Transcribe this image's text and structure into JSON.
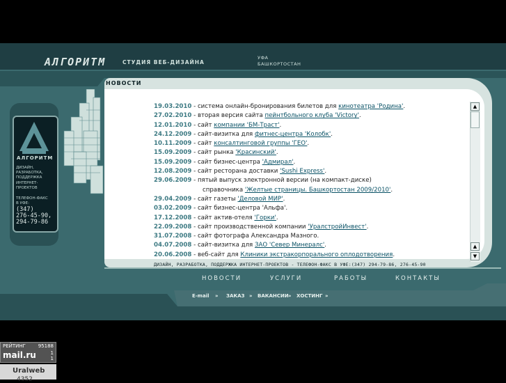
{
  "brand": {
    "name": "АЛГОРИТМ",
    "studio": "СТУДИЯ ВЕБ-ДИЗАЙНА",
    "city": "УФА",
    "region": "БАШКОРТОСТАН"
  },
  "left_card": {
    "name": "АЛГОРИТМ",
    "services": [
      "ДИЗАЙН,",
      "РАЗРАБОТКА,",
      "ПОДДЕРЖКА",
      "ИНТЕРНЕТ-",
      "ПРОЕКТОВ"
    ],
    "phone_label": [
      "ТЕЛЕФОН-ФАКС",
      "В УФЕ:"
    ],
    "phone_code": "(347)",
    "phones": [
      "276-45-90,",
      "294-79-86"
    ]
  },
  "news": {
    "title": "НОВОСТИ",
    "items": [
      {
        "date": "19.03.2010",
        "pre": " - система онлайн-бронирования билетов для ",
        "link": "кинотеатра 'Родина'",
        "post": "."
      },
      {
        "date": "27.02.2010",
        "pre": " - вторая версия сайта ",
        "link": "пейнтбольного клуба 'Victory'",
        "post": "."
      },
      {
        "date": "12.01.2010",
        "pre": " - сайт ",
        "link": "компании 'БМ-Траст'",
        "post": "."
      },
      {
        "date": "24.12.2009",
        "pre": " - сайт-визитка для ",
        "link": "фитнес-центра 'Колобк'",
        "post": "."
      },
      {
        "date": "10.11.2009",
        "pre": " - сайт ",
        "link": "консалтинговой группы 'ГЕО'",
        "post": "."
      },
      {
        "date": "15.09.2009",
        "pre": " - сайт рынка ",
        "link": "'Красинский'",
        "post": "."
      },
      {
        "date": "15.09.2009",
        "pre": " - сайт бизнес-центра ",
        "link": "'Адмирал'",
        "post": "."
      },
      {
        "date": "12.08.2009",
        "pre": " - сайт ресторана доставки ",
        "link": "'Sushi Express'",
        "post": "."
      },
      {
        "date": "29.06.2009",
        "pre": " - пятый выпуск электронной версии (на компакт-диске)",
        "link": "",
        "post": ""
      },
      {
        "date": "",
        "pre": "справочника ",
        "link": "'Желтые страницы. Башкортостан 2009/2010'",
        "post": "."
      },
      {
        "date": "29.04.2009",
        "pre": " - сайт газеты ",
        "link": "'Деловой МИР'",
        "post": "."
      },
      {
        "date": "03.02.2009",
        "pre": " - сайт бизнес-центра 'Альфа'.",
        "link": "",
        "post": ""
      },
      {
        "date": "17.12.2008",
        "pre": " - сайт актив-отеля ",
        "link": "'Горки'",
        "post": "."
      },
      {
        "date": "22.09.2008",
        "pre": " - сайт производственной компании ",
        "link": "'УралстройИнвест'",
        "post": "."
      },
      {
        "date": "31.07.2008",
        "pre": " - сайт фотографа Александра Мазного.",
        "link": "",
        "post": ""
      },
      {
        "date": "04.07.2008",
        "pre": " - сайт-визитка для ",
        "link": "ЗАО 'Север Минералс'",
        "post": "."
      },
      {
        "date": "20.06.2008",
        "pre": " - веб-сайт для ",
        "link": "Клиники экстракорпорального оплодотворения",
        "post": "."
      }
    ]
  },
  "footer_line": "ДИЗАЙН, РАЗРАБОТКА, ПОДДЕРЖКА ИНТЕРНЕТ-ПРОЕКТОВ  -  ТЕЛЕФОН-ФАКС В УФЕ:(347) 294-79-86, 276-45-90",
  "nav": {
    "news": "НОВОСТИ",
    "services": "УСЛУГИ",
    "works": "РАБОТЫ",
    "contacts": "КОНТАКТЫ"
  },
  "subnav": {
    "email": "E-mail",
    "order": "ЗАКАЗ",
    "jobs": "ВАКАНСИИ",
    "hosting": "ХОСТИНГ"
  },
  "counters": {
    "rating_label": "РЕЙТИНГ",
    "rating_value": "95188",
    "mail_logo": "mail.ru",
    "mail_v1": "1",
    "mail_v2": "1",
    "uralweb_label": "Uralweb",
    "uralweb_value": "4352"
  },
  "scroll": {
    "up": "▲",
    "down": "▼"
  },
  "colors": {
    "frame": "#3b6a6e",
    "panel": "#d7e3e0",
    "date": "#3d7a83",
    "link": "#0a5266"
  }
}
